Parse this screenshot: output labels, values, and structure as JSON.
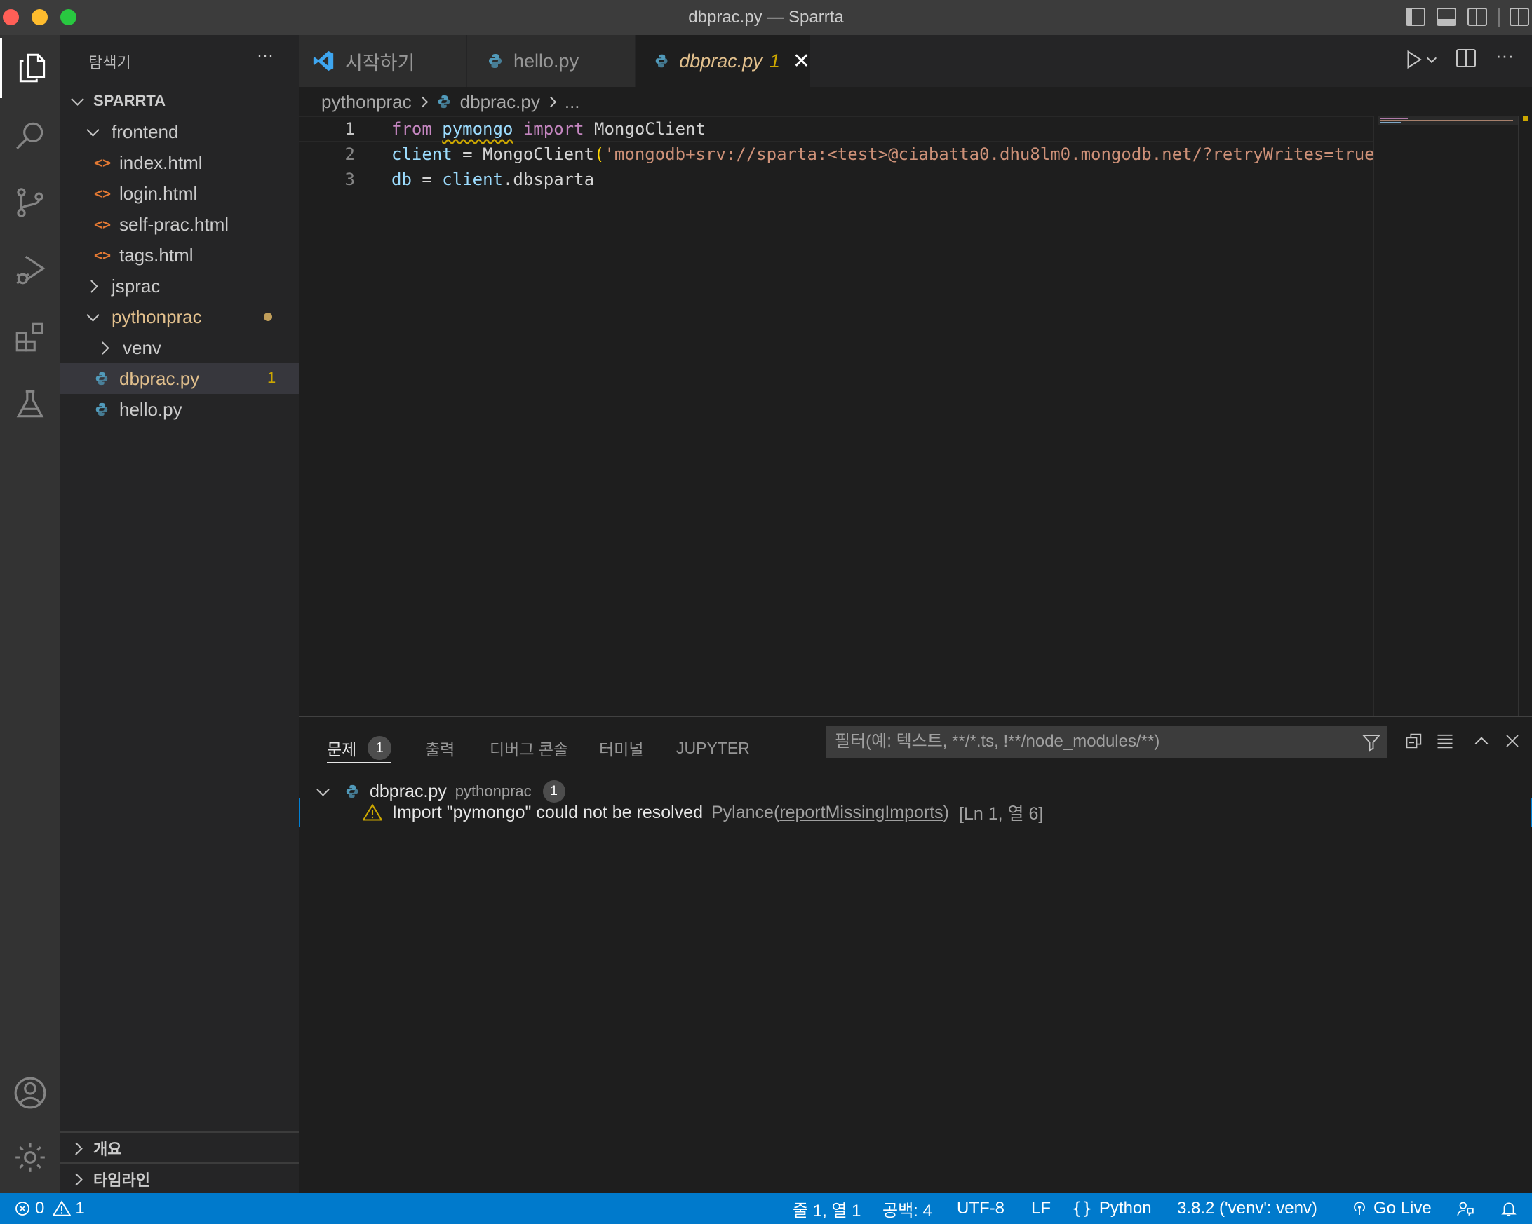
{
  "window": {
    "title": "dbprac.py — Sparrta"
  },
  "colors": {
    "accent": "#007acc",
    "warning": "#cca700",
    "modified": "#e2c08d",
    "html_icon": "#e37933",
    "python_icon": "#519aba"
  },
  "activity_bar": {
    "items": [
      "explorer-icon",
      "search-icon",
      "source-control-icon",
      "run-debug-icon",
      "extensions-icon",
      "testing-icon"
    ],
    "bottom": [
      "account-icon",
      "gear-icon"
    ]
  },
  "explorer": {
    "header": "탐색기",
    "more": "···",
    "workspace": "SPARRTA",
    "tree": [
      {
        "label": "frontend",
        "type": "folder",
        "expanded": true
      },
      {
        "label": "index.html",
        "type": "html"
      },
      {
        "label": "login.html",
        "type": "html"
      },
      {
        "label": "self-prac.html",
        "type": "html"
      },
      {
        "label": "tags.html",
        "type": "html"
      },
      {
        "label": "jsprac",
        "type": "folder",
        "expanded": false
      },
      {
        "label": "pythonprac",
        "type": "folder",
        "expanded": true
      },
      {
        "label": "venv",
        "type": "folder",
        "expanded": false
      },
      {
        "label": "dbprac.py",
        "type": "python",
        "problems": "1"
      },
      {
        "label": "hello.py",
        "type": "python"
      }
    ],
    "outline": "개요",
    "timeline": "타임라인"
  },
  "tabs": [
    {
      "label": "시작하기",
      "icon": "vscode-icon"
    },
    {
      "label": "hello.py",
      "icon": "python-icon"
    },
    {
      "label": "dbprac.py",
      "icon": "python-icon",
      "problems": "1",
      "active": true
    }
  ],
  "breadcrumb": {
    "folder": "pythonprac",
    "file": "dbprac.py",
    "more": "..."
  },
  "editor": {
    "lines": [
      {
        "num": "1",
        "tokens": [
          [
            "from",
            "kw"
          ],
          [
            " ",
            "op"
          ],
          [
            "pymongo",
            "var squig"
          ],
          [
            " ",
            "op"
          ],
          [
            "import",
            "kw"
          ],
          [
            " ",
            "op"
          ],
          [
            "MongoClient",
            "cls"
          ]
        ]
      },
      {
        "num": "2",
        "tokens": [
          [
            "client",
            "var"
          ],
          [
            " = ",
            "op"
          ],
          [
            "MongoClient",
            "cls"
          ],
          [
            "(",
            "paren"
          ],
          [
            "'mongodb+srv://sparta:<test>@ciabatta0.dhu8lm0.mongodb.net/?retryWrites=true",
            "str"
          ]
        ]
      },
      {
        "num": "3",
        "tokens": [
          [
            "db",
            "var"
          ],
          [
            " = ",
            "op"
          ],
          [
            "client",
            "var"
          ],
          [
            ".dbsparta",
            "cls"
          ]
        ]
      }
    ]
  },
  "panel": {
    "tabs": [
      "문제",
      "출력",
      "디버그 콘솔",
      "터미널",
      "JUPYTER"
    ],
    "problems_count": "1",
    "filter_placeholder": "필터(예: 텍스트, **/*.ts, !**/node_modules/**)",
    "group": {
      "file": "dbprac.py",
      "folder": "pythonprac",
      "count": "1"
    },
    "problem": {
      "message": "Import \"pymongo\" could not be resolved",
      "source": "Pylance(",
      "code": "reportMissingImports",
      "source_end": ")",
      "location": "[Ln 1, 열 6]"
    }
  },
  "statusbar": {
    "errors": "0",
    "warnings": "1",
    "position": "줄 1, 열 1",
    "spaces": "공백: 4",
    "encoding": "UTF-8",
    "eol": "LF",
    "language": "Python",
    "interpreter": "3.8.2 ('venv': venv)",
    "golive": "Go Live"
  }
}
